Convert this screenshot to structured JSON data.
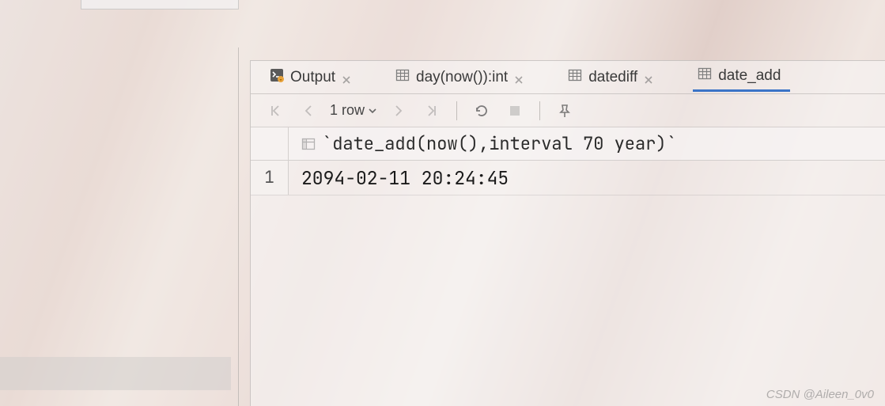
{
  "tabs": {
    "items": [
      {
        "label": "Output",
        "kind": "output",
        "active": false
      },
      {
        "label": "day(now()):int",
        "kind": "table",
        "active": false
      },
      {
        "label": "datediff",
        "kind": "table",
        "active": false
      },
      {
        "label": "date_add",
        "kind": "table",
        "active": true
      }
    ]
  },
  "toolbar": {
    "row_count_label": "1 row"
  },
  "result": {
    "column_header": "`date_add(now(),interval 70 year)`",
    "rows": [
      {
        "n": "1",
        "value": "2094-02-11 20:24:45"
      }
    ]
  },
  "watermark": "CSDN @Aileen_0v0"
}
